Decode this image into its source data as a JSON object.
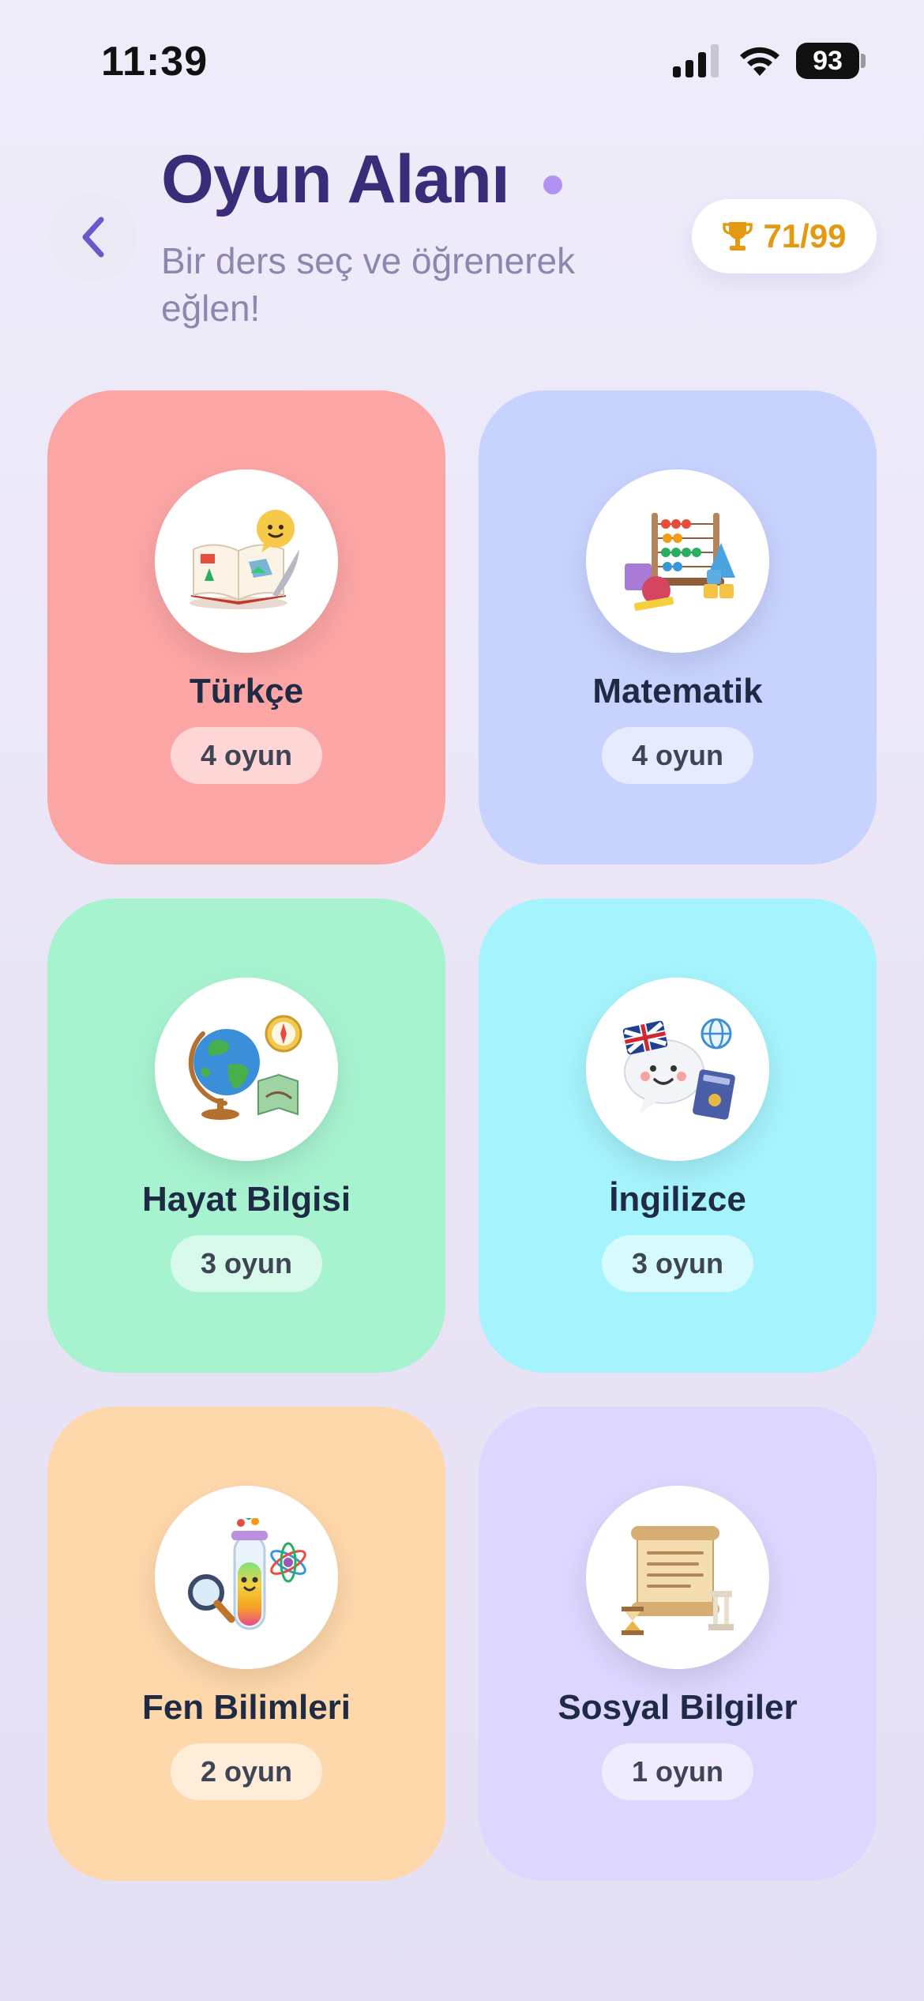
{
  "status_bar": {
    "time": "11:39",
    "battery": "93"
  },
  "header": {
    "title": "Oyun Alanı",
    "subtitle": "Bir ders seç ve öğrenerek eğlen!",
    "score": "71/99"
  },
  "subjects": [
    {
      "name": "Türkçe",
      "count": "4 oyun",
      "color": "#fca5a5",
      "icon": "book-icon"
    },
    {
      "name": "Matematik",
      "count": "4 oyun",
      "color": "#c7d2fe",
      "icon": "abacus-icon"
    },
    {
      "name": "Hayat Bilgisi",
      "count": "3 oyun",
      "color": "#a7f3d0",
      "icon": "globe-icon"
    },
    {
      "name": "İngilizce",
      "count": "3 oyun",
      "color": "#a5f3fc",
      "icon": "speech-bubble-icon"
    },
    {
      "name": "Fen Bilimleri",
      "count": "2 oyun",
      "color": "#fed7aa",
      "icon": "test-tube-icon"
    },
    {
      "name": "Sosyal Bilgiler",
      "count": "1 oyun",
      "color": "#ddd6fe",
      "icon": "scroll-icon"
    }
  ],
  "colors": {
    "title": "#3b2c7a",
    "accent_dot": "#b292f0",
    "score": "#e39a12",
    "back_arrow": "#6b57c9"
  }
}
